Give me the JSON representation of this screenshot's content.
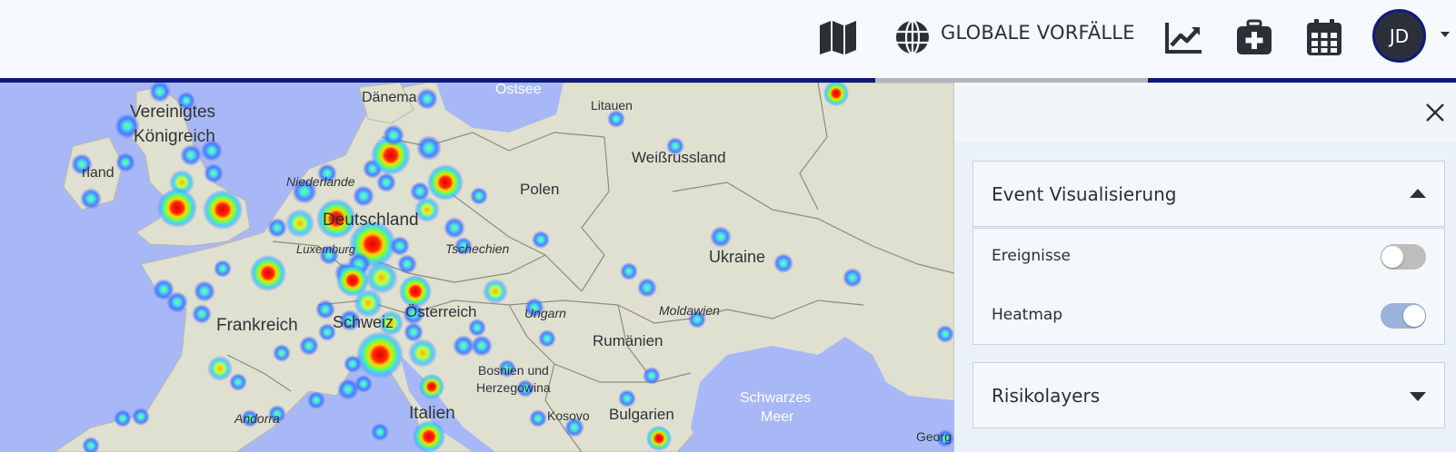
{
  "topbar": {
    "icons": [
      "map-icon",
      "globe-icon",
      "chart-line-icon",
      "medical-kit-icon",
      "calendar-icon"
    ],
    "nav_label": "GLOBALE VORFÄLLE",
    "avatar_initials": "JD",
    "accent_color": "#0e1a7a"
  },
  "map": {
    "labels": {
      "ostsee": "Ostsee",
      "daenemark": "Dänema",
      "vereinigtes": "Vereinigtes",
      "koenigreich": "Königreich",
      "irland": "rland",
      "niederlande": "Niederlande",
      "deutschland": "Deutschland",
      "luxemburg": "Luxemburg",
      "frankreich": "Frankreich",
      "schweiz": "Schweiz",
      "oesterreich": "Österreich",
      "tschechien": "Tschechien",
      "polen": "Polen",
      "litauen": "Litauen",
      "weissrussland": "Weißrussland",
      "ukraine": "Ukraine",
      "ungarn": "Ungarn",
      "moldawien": "Moldawien",
      "rumaenien": "Rumänien",
      "bosnien": "Bosnien und",
      "herzegowina": "Herzegowina",
      "kosovo": "Kosovo",
      "bulgarien": "Bulgarien",
      "schwarzes": "Schwarzes",
      "meer": "Meer",
      "andorra": "Andorra",
      "italien": "Italien",
      "georgien": "Georg"
    }
  },
  "panel": {
    "close_icon": "close-icon",
    "event_section": {
      "title": "Event Visualisierung",
      "expanded": true,
      "rows": [
        {
          "label": "Ereignisse",
          "enabled": false
        },
        {
          "label": "Heatmap",
          "enabled": true
        }
      ]
    },
    "risk_section": {
      "title": "Risikolayers",
      "expanded": false
    }
  }
}
